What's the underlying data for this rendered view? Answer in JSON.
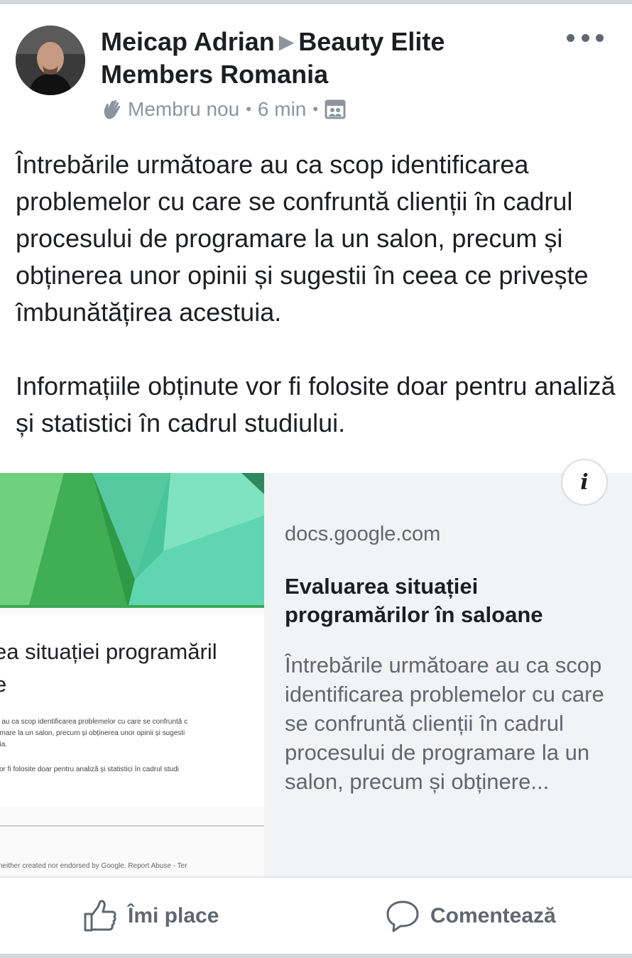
{
  "post": {
    "author": "Meicap Adrian",
    "group": "Beauty Elite Members Romania",
    "badge": "Membru nou",
    "time": "6 min",
    "paragraphs": [
      "Întrebările următoare au ca scop identificarea problemelor cu care se confruntă clienții în cadrul procesului de programare la un salon, precum și obținerea unor opinii și sugestii în ceea ce privește îmbunătățirea acestuia.",
      "Informațiile obținute vor fi folosite doar pentru analiză și statistici în cadrul studiului."
    ]
  },
  "link_preview": {
    "domain": "docs.google.com",
    "title": "Evaluarea situației programărilor în saloane",
    "description": "Întrebările următoare au ca scop identificarea problemelor cu care se confruntă clienții în cadrul procesului de programare la un salon, precum și obținere...",
    "info_label": "i",
    "thumbnail": {
      "form_title": "ea situației programăril",
      "form_title_2": "e",
      "line1": "e au ca scop identificarea problemelor cu care se confruntă c",
      "line2": "amare la un salon, precum și obținerea unor opinii și sugesti",
      "line3": "uia.",
      "line4": "vor fi folosite doar pentru analiză și statistici în cadrul studi",
      "footer": "neither created nor endorsed by Google. Report Abuse - Ter"
    }
  },
  "actions": {
    "like": "Îmi place",
    "comment": "Comentează"
  },
  "colors": {
    "text": "#1c1e21",
    "secondary": "#606770",
    "preview_bg": "#f2f3f5",
    "forms_green": "#43b65e"
  }
}
